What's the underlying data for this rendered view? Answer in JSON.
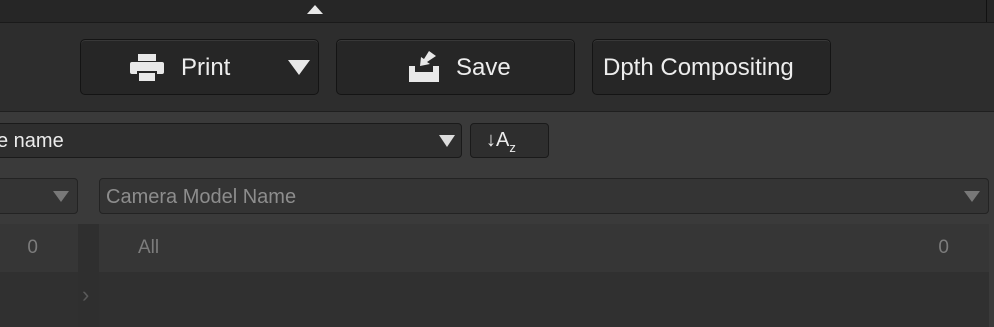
{
  "toolbar": {
    "print_label": "Print",
    "save_label": "Save",
    "depth_label": "Dpth Compositing"
  },
  "sort": {
    "field_value": "e name",
    "az_main": "A",
    "az_sub": "z"
  },
  "filter": {
    "left_column_value": "",
    "right_column_value": "Camera Model Name"
  },
  "lists": {
    "left": {
      "count": "0"
    },
    "right": {
      "item_name": "All",
      "count": "0"
    }
  },
  "icons": {
    "collapse": "triangle-up-icon",
    "print": "printer-icon",
    "print_dropdown": "triangle-down-icon",
    "save": "save-tray-icon",
    "sort": "sort-az-icon",
    "splitter": "chevron-right-icon"
  },
  "colors": {
    "background": "#2b2b2b",
    "panel": "#3a3a3a",
    "button": "#262626",
    "text": "#ededed",
    "muted_text": "#8d8d8d"
  }
}
